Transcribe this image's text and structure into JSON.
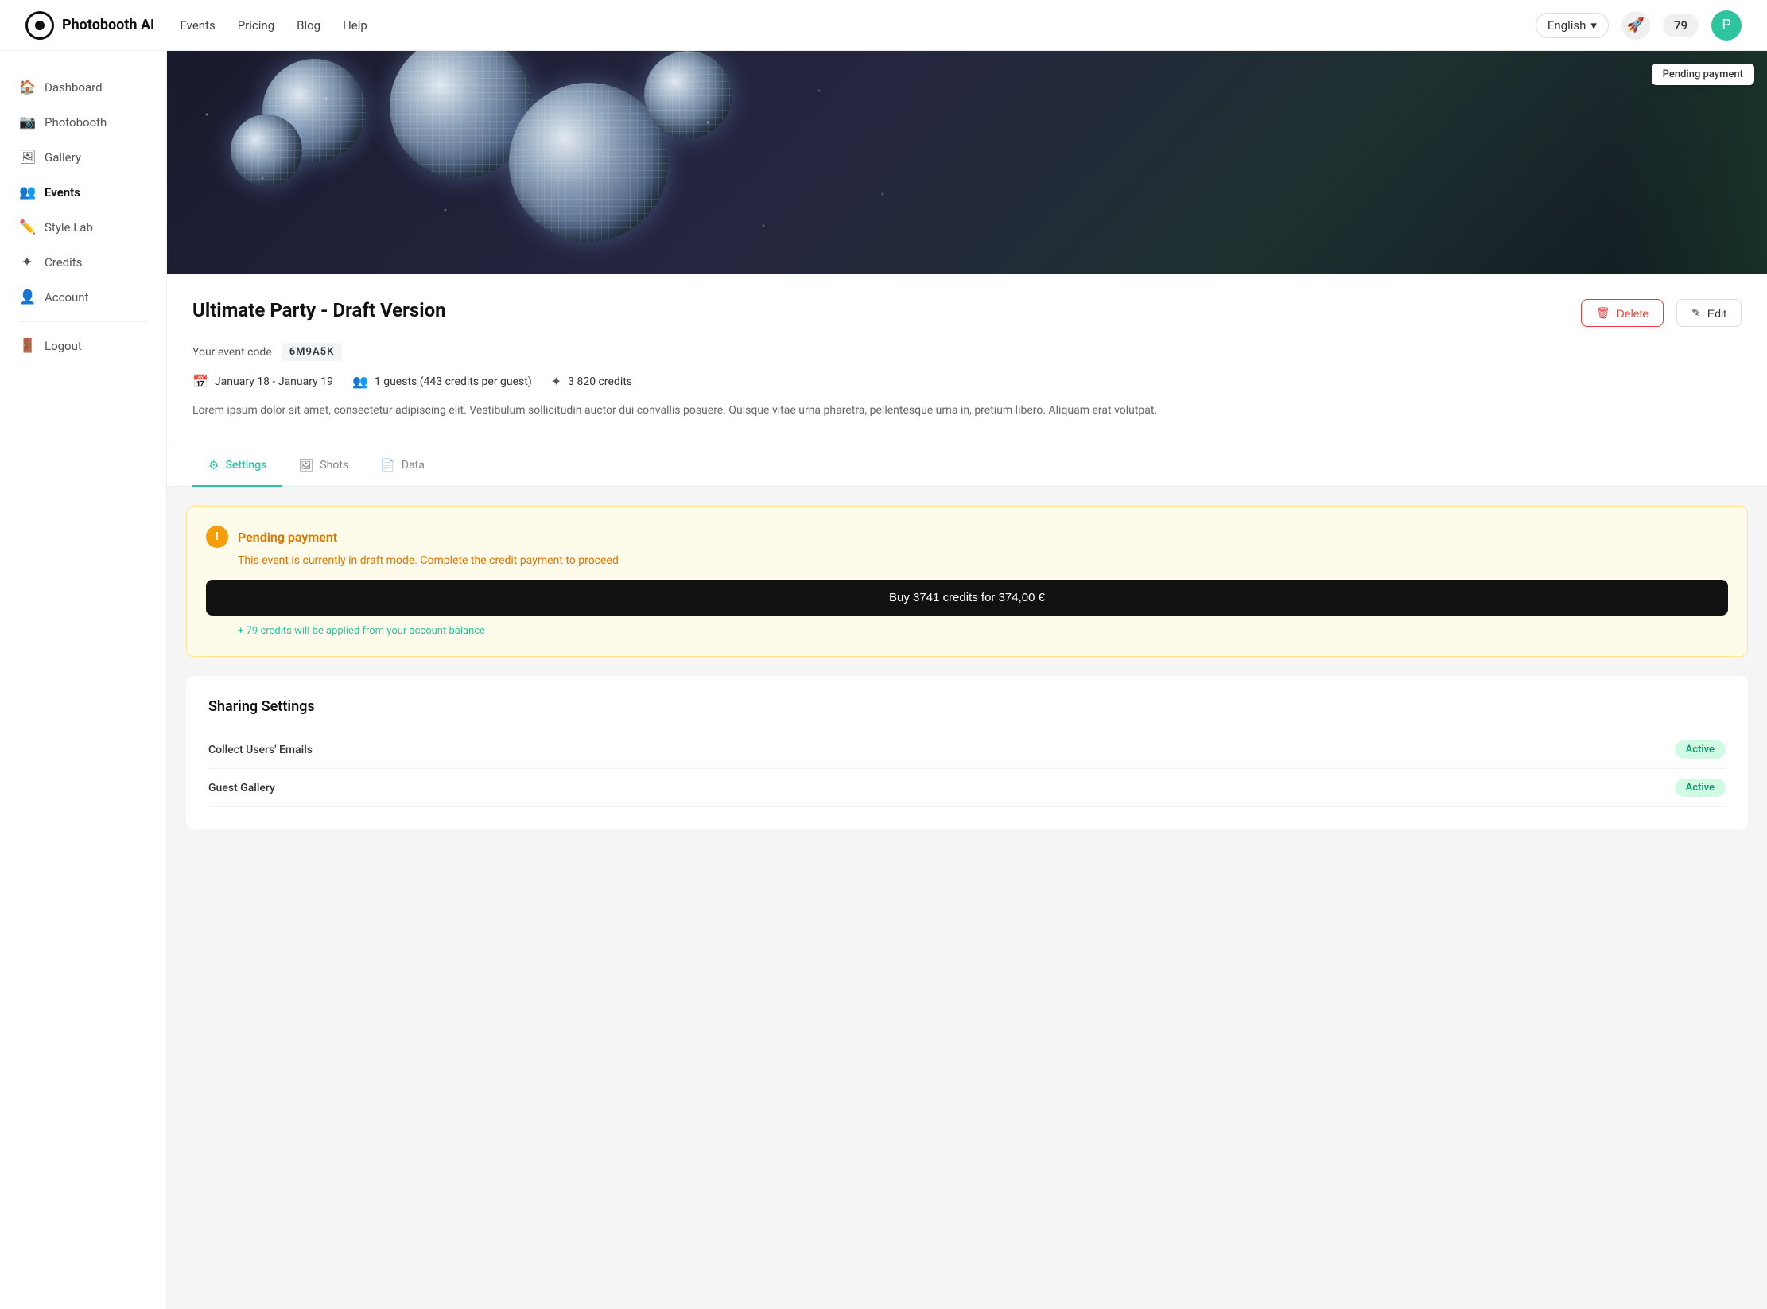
{
  "header": {
    "logo_text": "Photobooth AI",
    "nav": [
      {
        "label": "Events",
        "key": "events"
      },
      {
        "label": "Pricing",
        "key": "pricing"
      },
      {
        "label": "Blog",
        "key": "blog"
      },
      {
        "label": "Help",
        "key": "help"
      }
    ],
    "language": "English",
    "credits": "79",
    "avatar_initial": "P"
  },
  "sidebar": {
    "items": [
      {
        "label": "Dashboard",
        "icon": "🏠",
        "key": "dashboard",
        "active": false
      },
      {
        "label": "Photobooth",
        "icon": "📷",
        "key": "photobooth",
        "active": false
      },
      {
        "label": "Gallery",
        "icon": "🖼",
        "key": "gallery",
        "active": false
      },
      {
        "label": "Events",
        "icon": "👥",
        "key": "events",
        "active": true
      },
      {
        "label": "Style Lab",
        "icon": "✏️",
        "key": "stylelab",
        "active": false
      },
      {
        "label": "Credits",
        "icon": "✦",
        "key": "credits",
        "active": false
      },
      {
        "label": "Account",
        "icon": "👤",
        "key": "account",
        "active": false
      },
      {
        "label": "Logout",
        "icon": "🚪",
        "key": "logout",
        "active": false
      }
    ]
  },
  "event": {
    "pending_badge": "Pending payment",
    "title": "Ultimate Party - Draft Version",
    "code_label": "Your event code",
    "code": "6M9A5K",
    "date": "January 18 - January 19",
    "guests": "1 guests (443 credits per guest)",
    "credits": "3 820 credits",
    "description": "Lorem ipsum dolor sit amet, consectetur adipiscing elit. Vestibulum sollicitudin auctor dui convallis posuere. Quisque vitae urna pharetra, pellentesque urna in, pretium libero. Aliquam erat volutpat.",
    "delete_label": "Delete",
    "edit_label": "Edit"
  },
  "tabs": [
    {
      "label": "Settings",
      "icon": "⚙",
      "key": "settings",
      "active": true
    },
    {
      "label": "Shots",
      "icon": "🖼",
      "key": "shots",
      "active": false
    },
    {
      "label": "Data",
      "icon": "📄",
      "key": "data",
      "active": false
    }
  ],
  "pending_payment": {
    "title": "Pending payment",
    "description": "This event is currently in draft mode. Complete the credit payment to proceed",
    "buy_label": "Buy 3741 credits for 374,00 €",
    "credit_note": "+ 79 credits will be applied from your account balance"
  },
  "sharing": {
    "title": "Sharing Settings",
    "rows": [
      {
        "label": "Collect Users' Emails",
        "status": "Active"
      },
      {
        "label": "Guest Gallery",
        "status": "Active"
      }
    ]
  }
}
